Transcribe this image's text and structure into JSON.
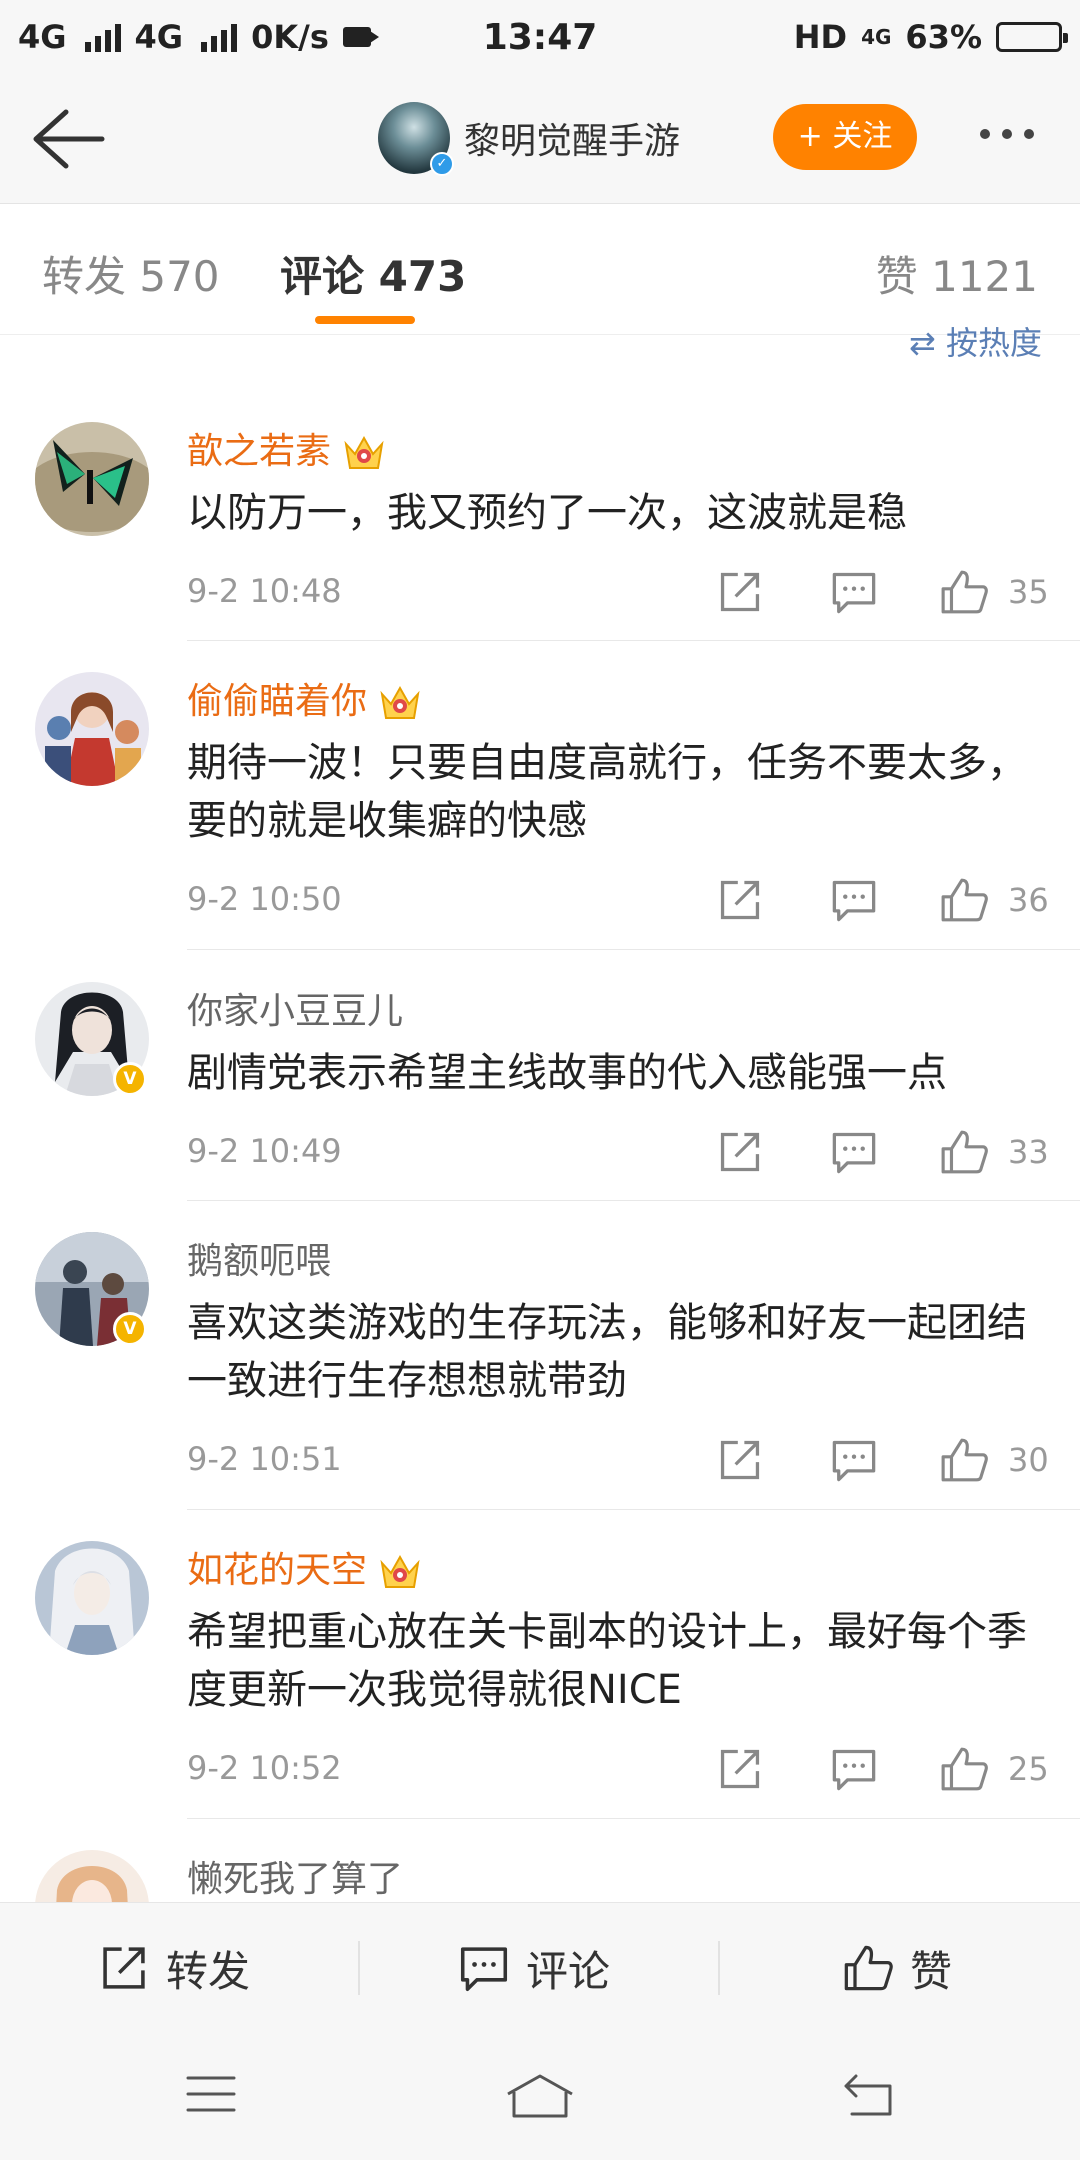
{
  "status": {
    "net1": "4G",
    "net2": "4G",
    "speed": "0K/s",
    "time": "13:47",
    "hd": "HD",
    "net3": "4G",
    "battery": "63%",
    "battery_level": 0.63
  },
  "header": {
    "account_name": "黎明觉醒手游",
    "follow_label": "+ 关注"
  },
  "tabs": [
    {
      "label": "转发 570"
    },
    {
      "label": "评论 473"
    },
    {
      "label": "赞 1121"
    }
  ],
  "sort_label": "⇄ 按热度",
  "comments": [
    {
      "name": "歆之若素",
      "text": "以防万一，我又预约了一次，这波就是稳",
      "time": "9-2 10:48",
      "likes": "35"
    },
    {
      "name": "偷偷瞄着你",
      "text": "期待一波！只要自由度高就行，任务不要太多，要的就是收集癖的快感",
      "time": "9-2 10:50",
      "likes": "36"
    },
    {
      "name": "你家小豆豆儿",
      "text": "剧情党表示希望主线故事的代入感能强一点",
      "time": "9-2 10:49",
      "likes": "33"
    },
    {
      "name": "鹅额呃喂",
      "text": "喜欢这类游戏的生存玩法，能够和好友一起团结一致进行生存想想就带劲",
      "time": "9-2 10:51",
      "likes": "30"
    },
    {
      "name": "如花的天空",
      "text": "希望把重心放在关卡副本的设计上，最好每个季度更新一次我觉得就很NICE",
      "time": "9-2 10:52",
      "likes": "25"
    },
    {
      "name": "懒死我了算了"
    }
  ],
  "bottom_bar": {
    "repost": "转发",
    "comment": "评论",
    "like": "赞"
  },
  "colors": {
    "accent": "#ff8200",
    "vip_name": "#ea6c14",
    "link": "#5b7fb5"
  }
}
